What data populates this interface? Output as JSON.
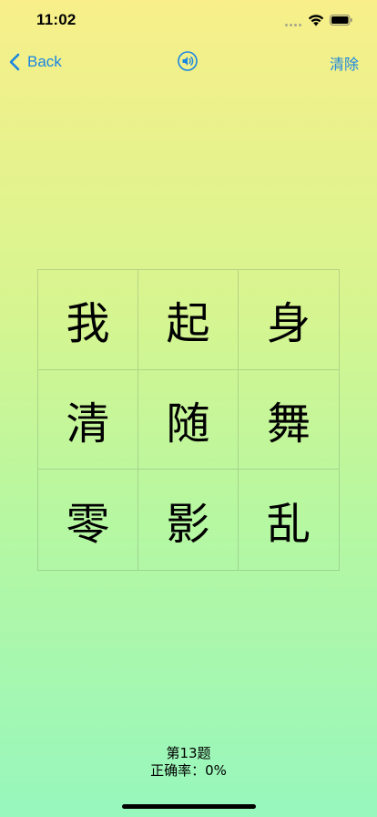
{
  "status_bar": {
    "time": "11:02"
  },
  "nav": {
    "back_label": "Back",
    "sound_icon": "speaker-icon",
    "clear_label": "清除"
  },
  "grid": {
    "cells": [
      "我",
      "起",
      "身",
      "清",
      "随",
      "舞",
      "零",
      "影",
      "乱"
    ]
  },
  "footer": {
    "question_label": "第13题",
    "accuracy_label": "正确率：0%"
  },
  "colors": {
    "accent": "#1a86e0",
    "gradient_top": "#f8ef8a",
    "gradient_bottom": "#97f7bd"
  }
}
